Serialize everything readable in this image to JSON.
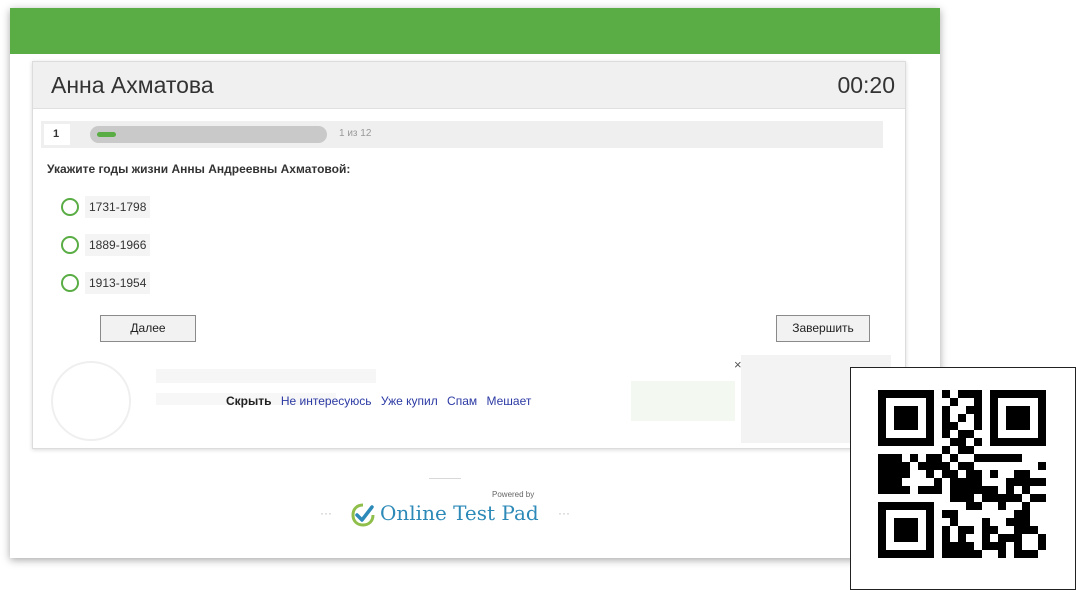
{
  "quiz": {
    "title": "Анна Ахматова",
    "timer": "00:20",
    "question_number": "1",
    "progress_text": "1 из 12",
    "progress_fraction": 0.0833,
    "question": "Укажите годы жизни Анны Андреевны Ахматовой:",
    "options": [
      {
        "label": "1731-1798",
        "selected": false
      },
      {
        "label": "1889-1966",
        "selected": false
      },
      {
        "label": "1913-1954",
        "selected": false
      }
    ],
    "next_label": "Далее",
    "finish_label": "Завершить"
  },
  "ad": {
    "close": "×",
    "hide": "Скрыть",
    "links": [
      "Не интересуюсь",
      "Уже купил",
      "Спам",
      "Мешает"
    ]
  },
  "footer": {
    "powered_by": "Powered by",
    "brand": "Online Test Pad",
    "dots": "···"
  },
  "colors": {
    "brand_green": "#5aad45",
    "link_blue": "#2c3aa4",
    "brand_blue": "#2d8ab8"
  }
}
